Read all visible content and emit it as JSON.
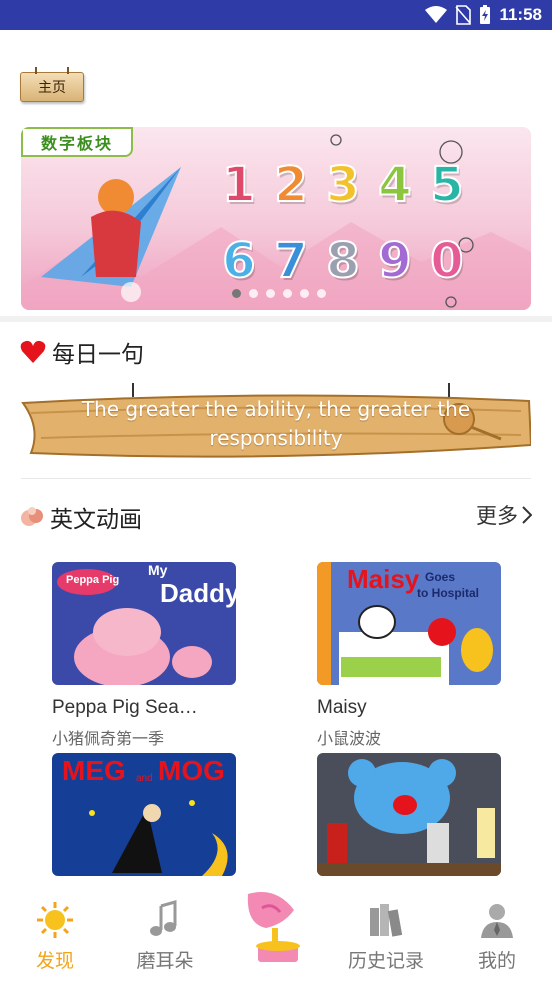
{
  "status_bar": {
    "time": "11:58",
    "icons": [
      "wifi-icon",
      "no-sim-icon",
      "battery-charging-icon"
    ]
  },
  "header": {
    "home_label": "主页"
  },
  "banner": {
    "tag": "数字板块",
    "digits_top": [
      "1",
      "2",
      "3",
      "4",
      "5"
    ],
    "digits_bottom": [
      "6",
      "7",
      "8",
      "9",
      "0"
    ],
    "digit_colors_top": [
      "#e04a6a",
      "#f08a33",
      "#f2c22c",
      "#8cc63f",
      "#29b5a5"
    ],
    "digit_colors_bottom": [
      "#4ab0e6",
      "#3b8fd9",
      "#9aa0b0",
      "#a36ad3",
      "#e65a96"
    ],
    "page_count": 6,
    "active_page": 1
  },
  "daily": {
    "title": "每日一句",
    "quote": "The greater the ability, the greater the responsibility"
  },
  "cartoons": {
    "title": "英文动画",
    "more": "更多",
    "items": [
      {
        "title": "Peppa Pig Sea…",
        "subtitle": "小猪佩奇第一季",
        "thumb_text": [
          "Peppa Pig",
          "My",
          "Daddy"
        ]
      },
      {
        "title": "Maisy",
        "subtitle": "小鼠波波",
        "thumb_text": [
          "Maisy",
          "Goes",
          "to Hospital"
        ]
      },
      {
        "title": "",
        "subtitle": "",
        "thumb_text": [
          "MEG",
          "and",
          "MOG"
        ]
      },
      {
        "title": "",
        "subtitle": "",
        "thumb_text": []
      }
    ]
  },
  "tabbar": {
    "tabs": [
      {
        "label": "发现",
        "icon": "sun-icon",
        "active": true
      },
      {
        "label": "磨耳朵",
        "icon": "music-note-icon",
        "active": false
      },
      {
        "label": "",
        "icon": "gramophone-icon",
        "active": false
      },
      {
        "label": "历史记录",
        "icon": "books-icon",
        "active": false
      },
      {
        "label": "我的",
        "icon": "user-icon",
        "active": false
      }
    ],
    "active_color": "#f3a41b"
  }
}
